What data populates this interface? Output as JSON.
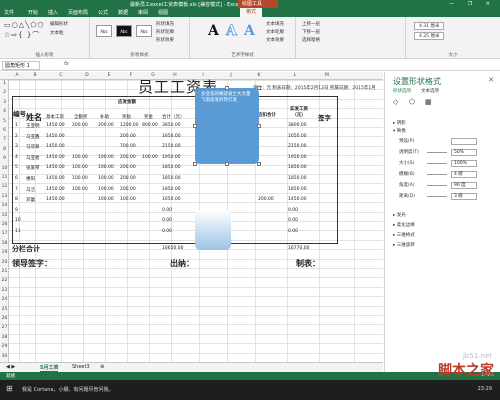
{
  "window": {
    "title": "最新员工excel工资表模板.xls [兼容模式] - Excel",
    "context_tab": "绘图工具",
    "controls": "—  ❐  ✕"
  },
  "tabs": [
    "文件",
    "开始",
    "插入",
    "页面布局",
    "公式",
    "数据",
    "审阅",
    "视图",
    "格式"
  ],
  "ribbon": {
    "insert_shapes": {
      "label": "插入形状",
      "edit_shape": "编辑形状",
      "text_box": "文本框"
    },
    "shape_styles": {
      "label": "形状样式",
      "swatches": [
        "Abc",
        "Abc",
        "Abc"
      ],
      "fill": "形状填充",
      "outline": "形状轮廓",
      "effects": "形状效果"
    },
    "wordart": {
      "label": "艺术字样式",
      "letters": [
        "A",
        "A",
        "A"
      ],
      "text_fill": "文本填充",
      "text_outline": "文本轮廓",
      "text_effects": "文本效果"
    },
    "arrange": {
      "up": "上移一层",
      "down": "下移一层",
      "pane": "选择窗格"
    },
    "size": {
      "label": "大小",
      "height": "4.31 厘米",
      "width": "4.25 厘米"
    }
  },
  "formula_bar": {
    "name_box": "圆角矩形 1",
    "fx": "fx"
  },
  "columns": [
    "A",
    "B",
    "C",
    "D",
    "E",
    "F",
    "G",
    "H",
    "I",
    "J",
    "K",
    "L",
    "M"
  ],
  "rows": [
    "1",
    "2",
    "3",
    "4",
    "5",
    "6",
    "7",
    "8",
    "9",
    "10",
    "11",
    "12",
    "13",
    "14",
    "15",
    "16",
    "17",
    "18",
    "19",
    "20",
    "21",
    "22",
    "23",
    "24",
    "25",
    "26",
    "27",
    "28",
    "29",
    "30"
  ],
  "sheet": {
    "title": "员工工资表",
    "unit_date": "单位：元  制表日期：2015年2月12日  所属日期：2015年1月",
    "hdr_no": "编号",
    "hdr_name": "姓名",
    "hdr_payable": "应发金额",
    "sub_headers": [
      "基本工资",
      "全勤奖",
      "补助",
      "奖励",
      "奖金",
      "合计（元）"
    ],
    "hdr_tax": "应扣合计",
    "hdr_actual": "实发工资（元）",
    "hdr_sign": "签字",
    "employees": [
      {
        "no": "1",
        "name": "王亚明",
        "vals": [
          "1450.00",
          "200.00",
          "200.00",
          "1200.00",
          "800.00",
          "3850.00"
        ],
        "actual": "3800.00"
      },
      {
        "no": "2",
        "name": "马亚鑫",
        "vals": [
          "1450.00",
          "",
          "",
          "200.00",
          "",
          "1650.00"
        ],
        "actual": "1650.00"
      },
      {
        "no": "3",
        "name": "马双翠",
        "vals": [
          "1450.00",
          "",
          "",
          "700.00",
          "",
          "2150.00"
        ],
        "actual": "2150.00"
      },
      {
        "no": "4",
        "name": "马亚者",
        "vals": [
          "1450.00",
          "100.00",
          "100.00",
          "200.00",
          "100.00",
          "1950.00"
        ],
        "actual": "1950.00"
      },
      {
        "no": "5",
        "name": "张爱琴",
        "vals": [
          "1450.00",
          "100.00",
          "100.00",
          "200.00",
          "",
          "1850.00"
        ],
        "actual": "1850.00"
      },
      {
        "no": "6",
        "name": "惠阳",
        "vals": [
          "1450.00",
          "100.00",
          "100.00",
          "200.00",
          "",
          "1850.00"
        ],
        "actual": "1850.00"
      },
      {
        "no": "7",
        "name": "马洁",
        "vals": [
          "1450.00",
          "100.00",
          "100.00",
          "200.00",
          "",
          "1850.00"
        ],
        "actual": "1850.00"
      },
      {
        "no": "8",
        "name": "邓蕾",
        "vals": [
          "1450.00",
          "",
          "100.00",
          "100.00",
          "",
          "1650.00"
        ],
        "tax": "200.00",
        "actual": "1450.00"
      },
      {
        "no": "9",
        "name": "",
        "vals": [
          "",
          "",
          "",
          "",
          "",
          "0.00"
        ],
        "actual": "0.00"
      },
      {
        "no": "10",
        "name": "",
        "vals": [
          "",
          "",
          "",
          "",
          "",
          "0.00"
        ],
        "actual": "0.00"
      },
      {
        "no": "11",
        "name": "",
        "vals": [
          "",
          "",
          "",
          "",
          "",
          "0.00"
        ],
        "actual": "0.00"
      }
    ],
    "subtotal_label": "分栏合计",
    "subtotal": "16650.00",
    "subtotal_actual": "16770.00",
    "sign_leader": "领导签字：",
    "sign_cashier": "出纳：",
    "sign_maker": "制表："
  },
  "shape": {
    "text": "多变宽的阁适发士大大量飞酒发发的赞打发"
  },
  "sheet_tabs": [
    "5月工资",
    "Sheet3",
    "⊕"
  ],
  "task_pane": {
    "title": "设置形状格式",
    "close": "✕",
    "tab_shape": "形状选项",
    "tab_text": "文本选项",
    "sections": [
      "阴影",
      "映像",
      "发光",
      "柔化边缘",
      "三维格式",
      "三维旋转"
    ],
    "glow_props": [
      {
        "label": "预设(P)",
        "value": ""
      },
      {
        "label": "透明度(T)",
        "value": "50%"
      },
      {
        "label": "大小(S)",
        "value": "100%"
      },
      {
        "label": "模糊(B)",
        "value": "4 磅"
      },
      {
        "label": "角度(A)",
        "value": "90 度"
      },
      {
        "label": "距离(D)",
        "value": "3 磅"
      }
    ]
  },
  "status": {
    "ready": "就绪",
    "zoom": "100%"
  },
  "taskbar": {
    "search": "我是 Cortana，小娜。有问题尽管问我。",
    "time": "23:29"
  },
  "watermark": {
    "url": "jb51.net",
    "brand": "脚本之家"
  }
}
